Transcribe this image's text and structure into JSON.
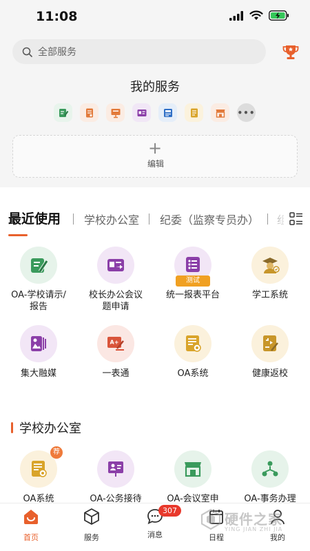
{
  "status_bar": {
    "time": "11:08"
  },
  "search": {
    "placeholder": "全部服务"
  },
  "my_services": {
    "title": "我的服务",
    "icons": [
      {
        "name": "edit-doc-icon",
        "color": "#e8f4ec"
      },
      {
        "name": "document-icon",
        "color": "#fbece3"
      },
      {
        "name": "presentation-icon",
        "color": "#fbece3"
      },
      {
        "name": "video-card-icon",
        "color": "#f1e7f6"
      },
      {
        "name": "id-card-icon",
        "color": "#e5eef9"
      },
      {
        "name": "notes-icon",
        "color": "#fbf2dd"
      },
      {
        "name": "storefront-icon",
        "color": "#fbece3"
      }
    ],
    "more_label": "•••",
    "edit_label": "编辑"
  },
  "tabs": [
    {
      "label": "最近使用",
      "active": true
    },
    {
      "label": "学校办公室",
      "active": false
    },
    {
      "label": "纪委（监察专员办）",
      "active": false
    },
    {
      "label": "组",
      "active": false
    }
  ],
  "recent": [
    {
      "label": "OA-学校请示/报告",
      "line1": "OA-学校请示/",
      "line2": "报告",
      "icon": "edit-doc-icon",
      "bg": "#e6f3ea",
      "fg": "#3a9a5c"
    },
    {
      "label": "校长办公会议题申请",
      "line1": "校长办公会议",
      "line2": "题申请",
      "icon": "video-card-icon",
      "bg": "#f2e6f6",
      "fg": "#8b3fa8"
    },
    {
      "label": "统一报表平台",
      "line1": "统一报表平台",
      "line2": "",
      "icon": "list-icon",
      "bg": "#f2e6f6",
      "fg": "#8b3fa8",
      "badge": "测试"
    },
    {
      "label": "学工系统",
      "line1": "学工系统",
      "line2": "",
      "icon": "graduate-icon",
      "bg": "#fbf1dc",
      "fg": "#c8962a"
    },
    {
      "label": "集大融媒",
      "line1": "集大融媒",
      "line2": "",
      "icon": "media-icon",
      "bg": "#f2e6f6",
      "fg": "#8b3fa8"
    },
    {
      "label": "一表通",
      "line1": "一表通",
      "line2": "",
      "icon": "grade-board-icon",
      "bg": "#fbe7e3",
      "fg": "#d9543a"
    },
    {
      "label": "OA系统",
      "line1": "OA系统",
      "line2": "",
      "icon": "oa-doc-icon",
      "bg": "#fbf1dc",
      "fg": "#c8962a"
    },
    {
      "label": "健康返校",
      "line1": "健康返校",
      "line2": "",
      "icon": "health-doc-icon",
      "bg": "#fbf1dc",
      "fg": "#c8962a"
    }
  ],
  "section": {
    "title": "学校办公室",
    "items": [
      {
        "label": "OA系统",
        "icon": "oa-doc-icon",
        "bg": "#fbf1dc",
        "fg": "#c8962a",
        "badge": "荐"
      },
      {
        "label": "OA-公务接待",
        "icon": "reception-icon",
        "bg": "#f2e6f6",
        "fg": "#8b3fa8"
      },
      {
        "label": "OA-会议室申",
        "icon": "meeting-room-icon",
        "bg": "#e6f3ea",
        "fg": "#3a9a5c"
      },
      {
        "label": "OA-事务办理",
        "icon": "workflow-icon",
        "bg": "#e6f3ea",
        "fg": "#3a9a5c"
      }
    ]
  },
  "bottom_nav": [
    {
      "label": "首页",
      "icon": "home-icon",
      "active": true
    },
    {
      "label": "服务",
      "icon": "cube-icon",
      "active": false
    },
    {
      "label": "消息",
      "icon": "chat-icon",
      "active": false,
      "badge": "307"
    },
    {
      "label": "日程",
      "icon": "calendar-icon",
      "active": false
    },
    {
      "label": "我的",
      "icon": "user-icon",
      "active": false
    }
  ],
  "watermark": {
    "text": "硬件之家",
    "sub": "YING JIAN ZHI JIA"
  },
  "colors": {
    "accent": "#e8602c",
    "badge_red": "#e8392c"
  }
}
